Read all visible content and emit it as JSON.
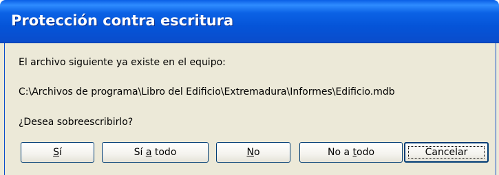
{
  "window": {
    "title": "Protección contra escritura"
  },
  "message": {
    "line1": "El archivo siguiente ya existe en el equipo:",
    "path": "C:\\Archivos de programa\\Libro del Edificio\\Extremadura\\Informes\\Edificio.mdb",
    "question": "¿Desea sobreescribirlo?"
  },
  "buttons": {
    "yes": {
      "before": "",
      "mnemonic": "S",
      "after": "í"
    },
    "yes_all": {
      "before": "Sí ",
      "mnemonic": "a",
      "after": " todo"
    },
    "no": {
      "before": "",
      "mnemonic": "N",
      "after": "o"
    },
    "no_all": {
      "before": "No a ",
      "mnemonic": "t",
      "after": "odo"
    },
    "cancel": "Cancelar"
  },
  "colors": {
    "titlebar": "#0554d8",
    "dialog_background": "#ece9d8",
    "button_border": "#003c74"
  }
}
